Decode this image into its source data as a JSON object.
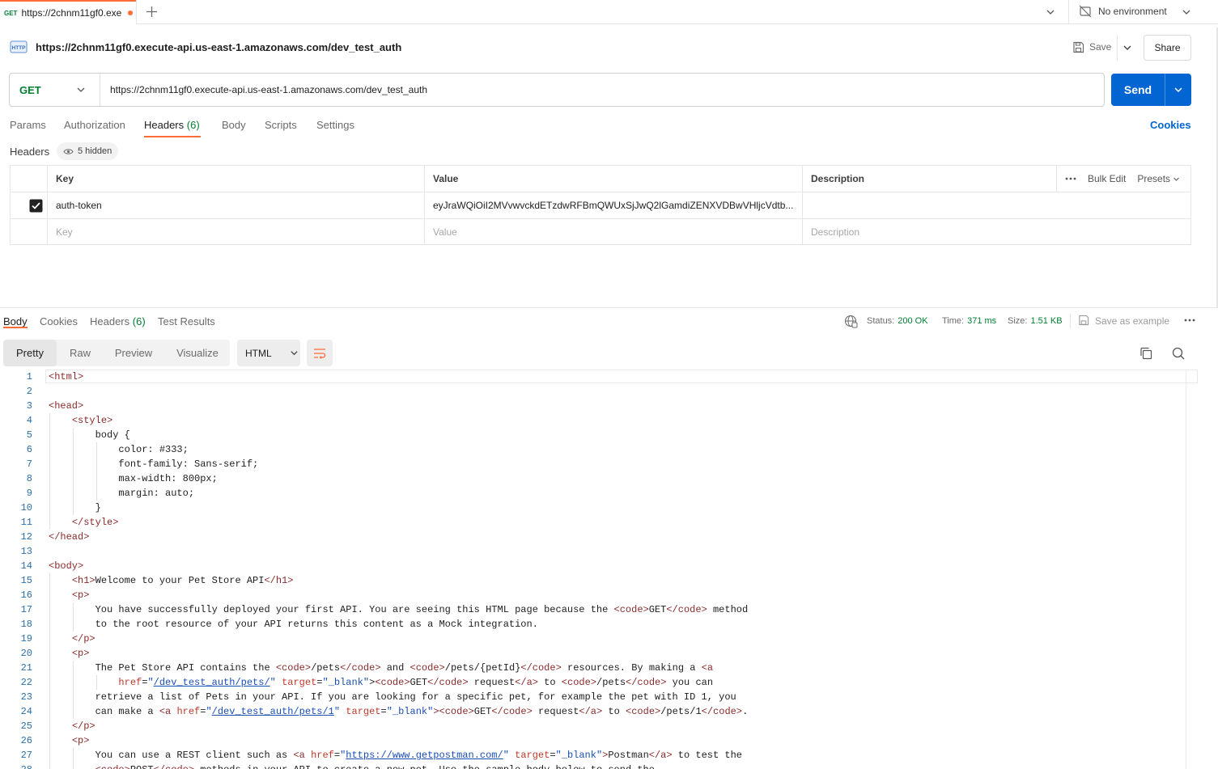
{
  "tab": {
    "method": "GET",
    "title": "https://2chnm11gf0.exe"
  },
  "environment": "No environment",
  "request": {
    "title_url": "https://2chnm11gf0.execute-api.us-east-1.amazonaws.com/dev_test_auth",
    "method": "GET",
    "url": "https://2chnm11gf0.execute-api.us-east-1.amazonaws.com/dev_test_auth",
    "save_label": "Save",
    "share_label": "Share",
    "send_label": "Send",
    "http_badge": "HTTP",
    "tabs": [
      {
        "label": "Params",
        "count": ""
      },
      {
        "label": "Authorization",
        "count": ""
      },
      {
        "label": "Headers",
        "count": "(6)"
      },
      {
        "label": "Body",
        "count": ""
      },
      {
        "label": "Scripts",
        "count": ""
      },
      {
        "label": "Settings",
        "count": ""
      }
    ],
    "cookies_label": "Cookies"
  },
  "headers_section": {
    "title": "Headers",
    "hidden_label": "5 hidden",
    "columns": {
      "key": "Key",
      "value": "Value",
      "description": "Description"
    },
    "bulk_edit": "Bulk Edit",
    "presets": "Presets",
    "rows": [
      {
        "checked": true,
        "key": "auth-token",
        "value": "eyJraWQiOiI2MVvwvckdETzdwRFBmQWUxSjJwQ2lGamdiZENXVDBwVHljcVdtb..."
      }
    ],
    "placeholder": {
      "key": "Key",
      "value": "Value",
      "description": "Description"
    }
  },
  "response": {
    "tabs": [
      {
        "label": "Body",
        "count": ""
      },
      {
        "label": "Cookies",
        "count": ""
      },
      {
        "label": "Headers",
        "count": "(6)"
      },
      {
        "label": "Test Results",
        "count": ""
      }
    ],
    "status_label": "Status:",
    "status_value": "200 OK",
    "time_label": "Time:",
    "time_value": "371 ms",
    "size_label": "Size:",
    "size_value": "1.51 KB",
    "save_example": "Save as example",
    "format_tabs": [
      "Pretty",
      "Raw",
      "Preview",
      "Visualize"
    ],
    "language": "HTML"
  },
  "code_lines": [
    "<html>",
    "",
    "<head>",
    "    <style>",
    "        body {",
    "            color: #333;",
    "            font-family: Sans-serif;",
    "            max-width: 800px;",
    "            margin: auto;",
    "        }",
    "    </style>",
    "</head>",
    "",
    "<body>",
    "    <h1>Welcome to your Pet Store API</h1>",
    "    <p>",
    "        You have successfully deployed your first API. You are seeing this HTML page because the <code>GET</code> method",
    "        to the root resource of your API returns this content as a Mock integration.",
    "    </p>",
    "    <p>",
    "        The Pet Store API contains the <code>/pets</code> and <code>/pets/{petId}</code> resources. By making a <a",
    "            href=\"/dev_test_auth/pets/\" target=\"_blank\"><code>GET</code> request</a> to <code>/pets</code> you can",
    "        retrieve a list of Pets in your API. If you are looking for a specific pet, for example the pet with ID 1, you",
    "        can make a <a href=\"/dev_test_auth/pets/1\" target=\"_blank\"><code>GET</code> request</a> to <code>/pets/1</code>.",
    "    </p>",
    "    <p>",
    "        You can use a REST client such as <a href=\"https://www.getpostman.com/\" target=\"_blank\">Postman</a> to test the",
    "        <code>POST</code> methods in your API to create a new pet. Use the sample body below to send the"
  ],
  "colors": {
    "accent": "#ff6c37",
    "send": "#0265d2",
    "get": "#007f31",
    "status_ok": "#007f31"
  }
}
